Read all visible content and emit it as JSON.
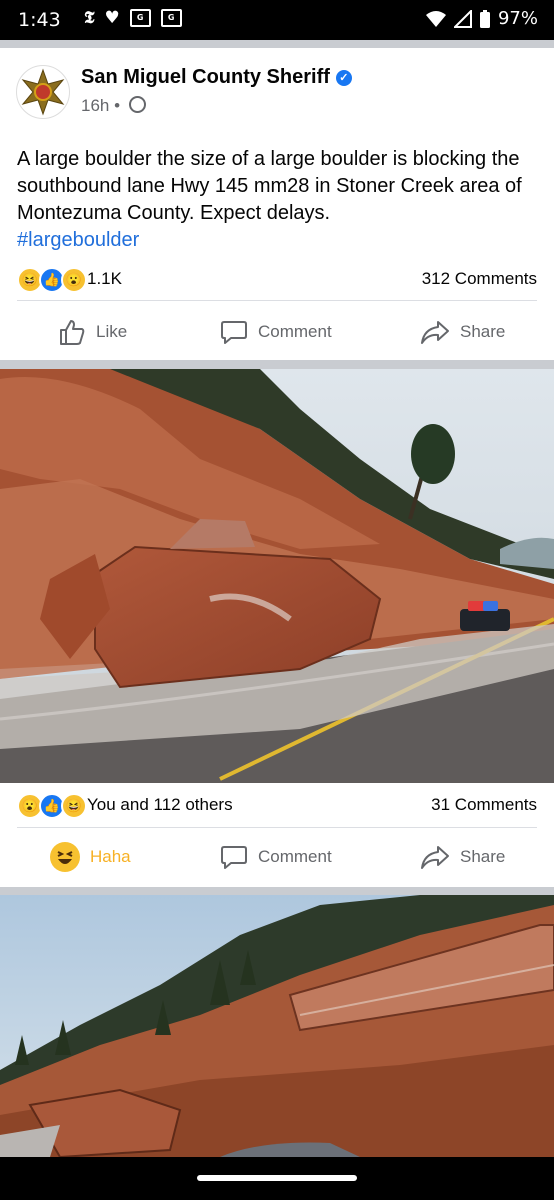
{
  "status_bar": {
    "time": "1:43",
    "left_icons": [
      "nyt-icon",
      "heart-icon",
      "google-news-icon",
      "google-news-icon"
    ],
    "battery": "97%"
  },
  "post1": {
    "page_name": "San Miguel County Sheriff",
    "time": "16h",
    "separator": "•",
    "text": "A large boulder the size of a large boulder is blocking the southbound lane Hwy 145 mm28 in Stoner Creek area of Montezuma County. Expect delays.",
    "hashtag": "#largeboulder",
    "reaction_count": "1.1K",
    "comments": "312 Comments",
    "actions": {
      "like": "Like",
      "comment": "Comment",
      "share": "Share"
    }
  },
  "photo1": {
    "reactions_text": "You and 112 others",
    "comments": "31 Comments",
    "actions": {
      "haha": "Haha",
      "comment": "Comment",
      "share": "Share"
    }
  },
  "colors": {
    "facebook_blue": "#1877f2",
    "haha_yellow": "#f7b125",
    "text_gray": "#65676b"
  }
}
